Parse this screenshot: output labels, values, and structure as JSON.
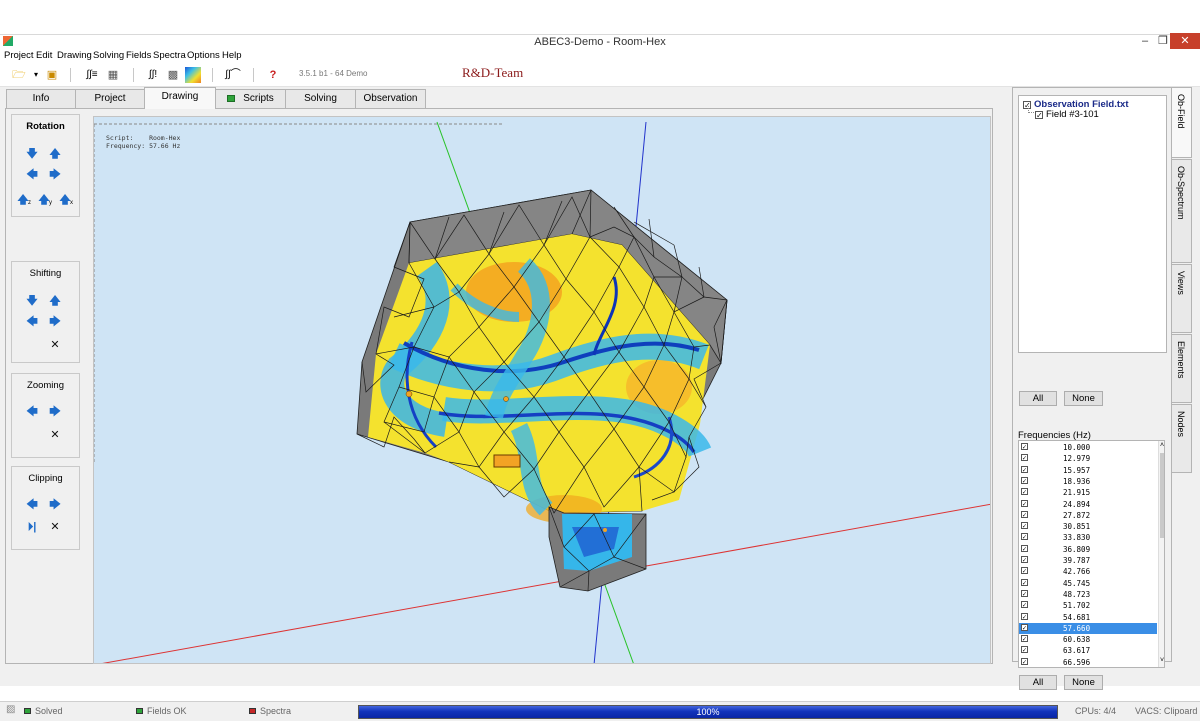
{
  "window": {
    "title": "ABEC3-Demo - Room-Hex",
    "minimize": "–",
    "restore": "❐",
    "close": "✕"
  },
  "menu": [
    "Project",
    "Edit",
    "Drawing",
    "Solving",
    "Fields",
    "Spectra",
    "Options",
    "Help"
  ],
  "toolbar": {
    "icons": [
      "open-folder-icon",
      "dropdown-arrow-icon",
      "save-icon",
      "integral-list-icon",
      "mesh-icon",
      "integral-run-icon",
      "field-mesh-icon",
      "colormap-icon",
      "integral-spectrum-icon",
      "help-icon"
    ],
    "version": "3.5.1 b1 - 64 Demo",
    "team": "R&D-Team"
  },
  "tabs": [
    {
      "label": "Info",
      "active": false
    },
    {
      "label": "Project",
      "active": false
    },
    {
      "label": "Drawing",
      "active": true
    },
    {
      "label": "Scripts",
      "active": false,
      "status": "green"
    },
    {
      "label": "Solving",
      "active": false
    },
    {
      "label": "Observation",
      "active": false
    }
  ],
  "controls": {
    "rotation": {
      "title": "Rotation",
      "sub_labels": [
        "z",
        "y",
        "x"
      ]
    },
    "shifting": {
      "title": "Shifting"
    },
    "zooming": {
      "title": "Zooming"
    },
    "clipping": {
      "title": "Clipping"
    },
    "reset_symbol": "✕"
  },
  "viewport": {
    "script_label": "Script:",
    "script_value": "Room-Hex",
    "frequency_label": "Frequency:",
    "frequency_value": "57.66 Hz"
  },
  "observation": {
    "file": "Observation Field.txt",
    "field": "Field #3-101",
    "all_button": "All",
    "none_button": "None"
  },
  "frequencies": {
    "label": "Frequencies  (Hz)",
    "selected": "57.660",
    "values": [
      "10.000",
      "12.979",
      "15.957",
      "18.936",
      "21.915",
      "24.894",
      "27.872",
      "30.851",
      "33.830",
      "36.809",
      "39.787",
      "42.766",
      "45.745",
      "48.723",
      "51.702",
      "54.681",
      "57.660",
      "60.638",
      "63.617",
      "66.596"
    ],
    "all_button": "All",
    "none_button": "None"
  },
  "side_tabs": [
    "Ob-Field",
    "Ob-Spectrum",
    "Views",
    "Elements",
    "Nodes"
  ],
  "status": {
    "solved": "Solved",
    "fields": "Fields OK",
    "spectra": "Spectra",
    "progress": "100%",
    "progress_value": 1.0,
    "cpus": "CPUs: 4/4",
    "vacs": "VACS: Clipoard"
  },
  "colors": {
    "ok": "#2ea33a",
    "error": "#c62828",
    "progress": "#1133bb",
    "selected": "#3a8ee6"
  }
}
